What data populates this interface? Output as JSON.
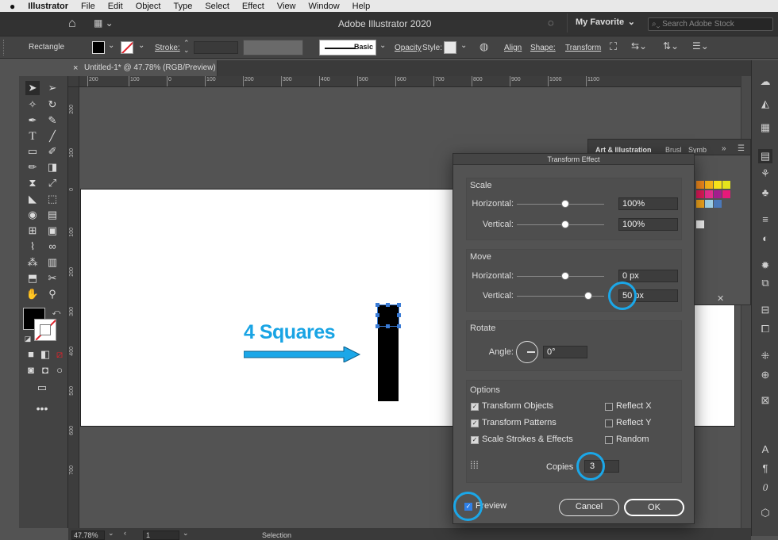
{
  "menubar": {
    "apple": "",
    "items": [
      "Illustrator",
      "File",
      "Edit",
      "Object",
      "Type",
      "Select",
      "Effect",
      "View",
      "Window",
      "Help"
    ]
  },
  "appbar": {
    "title": "Adobe Illustrator 2020",
    "workspace": "My Favorite",
    "search_placeholder": "Search Adobe Stock"
  },
  "control": {
    "object_type": "Rectangle",
    "stroke_label": "Stroke:",
    "brush": "Basic",
    "opacity": "Opacity",
    "style": "Style:",
    "align": "Align",
    "shape": "Shape:",
    "transform": "Transform"
  },
  "document": {
    "tab_title": "Untitled-1* @ 47.78% (RGB/Preview)",
    "close": "×"
  },
  "ruler": {
    "h": [
      "200",
      "100",
      "0",
      "100",
      "200",
      "300",
      "400",
      "500",
      "600",
      "700",
      "800",
      "900",
      "1000",
      "1100"
    ],
    "v": [
      "200",
      "100",
      "0",
      "100",
      "200",
      "300",
      "400",
      "500",
      "600",
      "700"
    ]
  },
  "canvas": {
    "headline": "4 Squares",
    "colors": {
      "accent": "#1ba7e8",
      "headline": "#19a4e4"
    }
  },
  "library_panel": {
    "tabs": [
      "Art & Illustration",
      "Brusl",
      "Symb"
    ],
    "more": "»"
  },
  "dialog": {
    "title": "Transform Effect",
    "scale": {
      "title": "Scale",
      "horizontal_label": "Horizontal:",
      "horizontal_value": "100%",
      "vertical_label": "Vertical:",
      "vertical_value": "100%"
    },
    "move": {
      "title": "Move",
      "horizontal_label": "Horizontal:",
      "horizontal_value": "0 px",
      "vertical_label": "Vertical:",
      "vertical_value": "50 px"
    },
    "rotate": {
      "title": "Rotate",
      "angle_label": "Angle:",
      "angle_value": "0°"
    },
    "options": {
      "title": "Options",
      "items": [
        {
          "label": "Transform Objects",
          "checked": true
        },
        {
          "label": "Transform Patterns",
          "checked": true
        },
        {
          "label": "Scale Strokes & Effects",
          "checked": true
        },
        {
          "label": "Reflect X",
          "checked": false
        },
        {
          "label": "Reflect Y",
          "checked": false
        },
        {
          "label": "Random",
          "checked": false
        }
      ],
      "copies_label": "Copies",
      "copies_value": "3"
    },
    "preview_label": "Preview",
    "preview_checked": true,
    "cancel": "Cancel",
    "ok": "OK"
  },
  "status": {
    "zoom": "47.78%",
    "artboard": "1",
    "tool": "Selection"
  }
}
